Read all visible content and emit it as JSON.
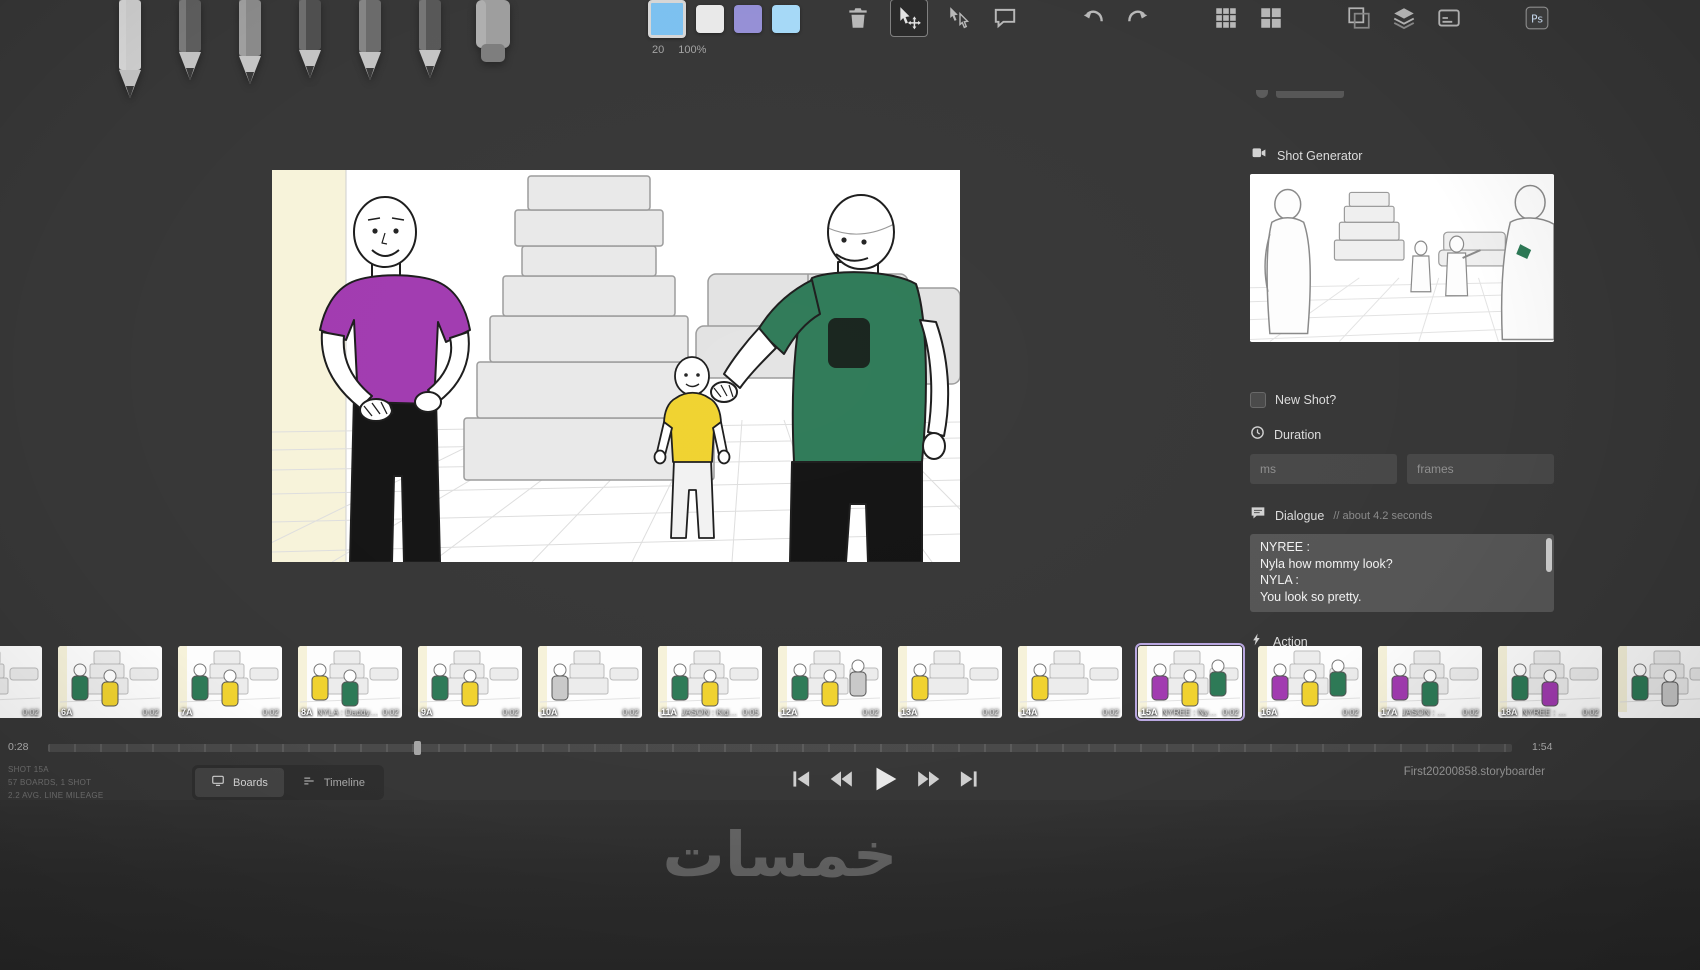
{
  "palette": {
    "purple": "#a13bb0",
    "yellow": "#f0d22f",
    "green": "#2e7a57",
    "gray": "#c9c9c9",
    "selection": "#b9a7e0"
  },
  "toolbar": {
    "brush_size": "20",
    "opacity": "100%",
    "tools": [
      {
        "name": "light-pencil",
        "color": "#cfcfcf",
        "len": 100,
        "kind": "pencil"
      },
      {
        "name": "pencil",
        "color": "#5e5e5e",
        "len": 82,
        "kind": "pencil"
      },
      {
        "name": "pen",
        "color": "#8a8a8a",
        "len": 86,
        "kind": "pencil"
      },
      {
        "name": "brush",
        "color": "#4f4f4f",
        "len": 80,
        "kind": "pencil"
      },
      {
        "name": "note-pen",
        "color": "#6b6b6b",
        "len": 82,
        "kind": "pencil"
      },
      {
        "name": "marker",
        "color": "#585858",
        "len": 80,
        "kind": "pencil"
      },
      {
        "name": "eraser",
        "color": "#9e9e9e",
        "len": 64,
        "kind": "block"
      }
    ],
    "swatches": [
      {
        "name": "current-color",
        "color": "#7cc1f0",
        "selected": true
      },
      {
        "name": "palette-color-1",
        "color": "#e9e9e9",
        "selected": false
      },
      {
        "name": "palette-color-2",
        "color": "#958fd6",
        "selected": false
      },
      {
        "name": "palette-color-3",
        "color": "#a6d9f7",
        "selected": false
      }
    ],
    "icons": [
      {
        "name": "trash",
        "selected": false,
        "gap_before": false
      },
      {
        "name": "pointer-move",
        "selected": true,
        "gap_before": false
      },
      {
        "name": "pointer-duplicate",
        "selected": false,
        "gap_before": false
      },
      {
        "name": "comment",
        "selected": false,
        "gap_before": false
      },
      {
        "name": "undo",
        "selected": false,
        "gap_before": true
      },
      {
        "name": "redo",
        "selected": false,
        "gap_before": false
      },
      {
        "name": "grid",
        "selected": false,
        "gap_before": true
      },
      {
        "name": "thumbnails",
        "selected": false,
        "gap_before": false
      },
      {
        "name": "onion-skin",
        "selected": false,
        "gap_before": true
      },
      {
        "name": "layers",
        "selected": false,
        "gap_before": false
      },
      {
        "name": "captions",
        "selected": false,
        "gap_before": false
      },
      {
        "name": "photoshop",
        "selected": false,
        "gap_before": true
      }
    ]
  },
  "sidebar": {
    "shot_generator_label": "Shot Generator",
    "new_shot_label": "New Shot?",
    "duration_label": "Duration",
    "ms_placeholder": "ms",
    "frames_placeholder": "frames",
    "dialogue_label": "Dialogue",
    "dialogue_hint": "// about 4.2 seconds",
    "dialogue_text": "NYREE :\nNyla how mommy look?\nNYLA :\nYou look so pretty.",
    "action_label": "Action"
  },
  "timeline": {
    "current_time": "0:28",
    "total_time": "1:54",
    "progress_percent": 25,
    "boards": [
      {
        "num": "",
        "snippet": "",
        "duration": "0:02",
        "accents": [
          "gray"
        ],
        "selected": false
      },
      {
        "num": "6A",
        "snippet": "",
        "duration": "0:02",
        "accents": [
          "green",
          "yellow"
        ],
        "selected": false
      },
      {
        "num": "7A",
        "snippet": "",
        "duration": "0:02",
        "accents": [
          "green",
          "yellow"
        ],
        "selected": false
      },
      {
        "num": "8A",
        "snippet": "NYLA : Daddy…",
        "duration": "0:02",
        "accents": [
          "yellow",
          "green"
        ],
        "selected": false
      },
      {
        "num": "9A",
        "snippet": "",
        "duration": "0:02",
        "accents": [
          "green",
          "yellow"
        ],
        "selected": false
      },
      {
        "num": "10A",
        "snippet": "",
        "duration": "0:02",
        "accents": [
          "gray"
        ],
        "selected": false
      },
      {
        "num": "11A",
        "snippet": "JASON : Kidz c…",
        "duration": "0:05",
        "accents": [
          "green",
          "yellow"
        ],
        "selected": false
      },
      {
        "num": "12A",
        "snippet": "",
        "duration": "0:02",
        "accents": [
          "green",
          "yellow",
          "gray"
        ],
        "selected": false
      },
      {
        "num": "13A",
        "snippet": "",
        "duration": "0:02",
        "accents": [
          "yellow"
        ],
        "selected": false
      },
      {
        "num": "14A",
        "snippet": "",
        "duration": "0:02",
        "accents": [
          "yellow"
        ],
        "selected": false
      },
      {
        "num": "15A",
        "snippet": "NYREE : Nyla…",
        "duration": "0:02",
        "accents": [
          "purple",
          "yellow",
          "green"
        ],
        "selected": true
      },
      {
        "num": "16A",
        "snippet": "",
        "duration": "0:02",
        "accents": [
          "purple",
          "yellow",
          "green"
        ],
        "selected": false
      },
      {
        "num": "17A",
        "snippet": "JASON : …",
        "duration": "0:02",
        "accents": [
          "purple",
          "green"
        ],
        "selected": false
      },
      {
        "num": "18A",
        "snippet": "NYREE : …",
        "duration": "0:02",
        "accents": [
          "green",
          "purple"
        ],
        "selected": false
      },
      {
        "num": "",
        "snippet": "",
        "duration": "",
        "accents": [
          "green",
          "gray"
        ],
        "selected": false
      }
    ]
  },
  "footer": {
    "shot_label": "SHOT 15A",
    "boards_label": "57 BOARDS, 1 SHOT",
    "mileage_label": "2.2 AVG. LINE MILEAGE",
    "boards_tab": "Boards",
    "timeline_tab": "Timeline",
    "transport": [
      "skip-start",
      "rewind",
      "play",
      "fast-forward",
      "skip-end"
    ],
    "filename": "First20200858.storyboarder"
  },
  "watermark_text": "خمسات"
}
